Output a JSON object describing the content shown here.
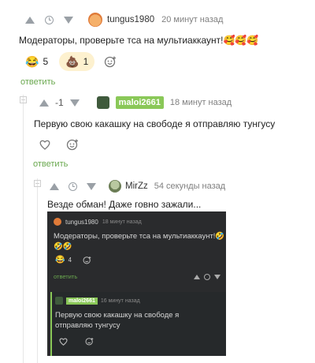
{
  "comment1": {
    "username": "tungus1980",
    "time": "20 минут назад",
    "text": "Модераторы, проверьте тса на мультиаккаунт!🥰🥰🥰",
    "reactions": [
      {
        "emoji": "😂",
        "count": "5"
      },
      {
        "emoji": "💩",
        "count": "1"
      }
    ],
    "reply_label": "ответить"
  },
  "comment2": {
    "rating": "-1",
    "username": "maloi2661",
    "time": "18 минут назад",
    "text": "Первую свою какашку на свободе я отправляю тунгусу",
    "reply_label": "ответить"
  },
  "comment3": {
    "username": "MirZz",
    "time": "54 секунды назад",
    "text": "Везде обман! Даже говно зажали..."
  },
  "embedded": {
    "c1_username": "tungus1980",
    "c1_time": "18 минут назад",
    "c1_text_line1": "Модераторы, проверьте тса на мультиаккаунт!🤣",
    "c1_text_line2": "🤣🤣",
    "c1_reaction_emoji": "😂",
    "c1_reaction_count": "4",
    "c1_reply_label": "ответить",
    "c2_username": "maloi2661",
    "c2_time": "16 минут назад",
    "c2_text_line1": "Первую свою какашку на свободе я",
    "c2_text_line2": "отправляю тунгусу"
  },
  "colors": {
    "accent_green": "#8ac858",
    "reply_green": "#6aa84f",
    "reaction_highlight_bg": "#fdf1cf"
  }
}
